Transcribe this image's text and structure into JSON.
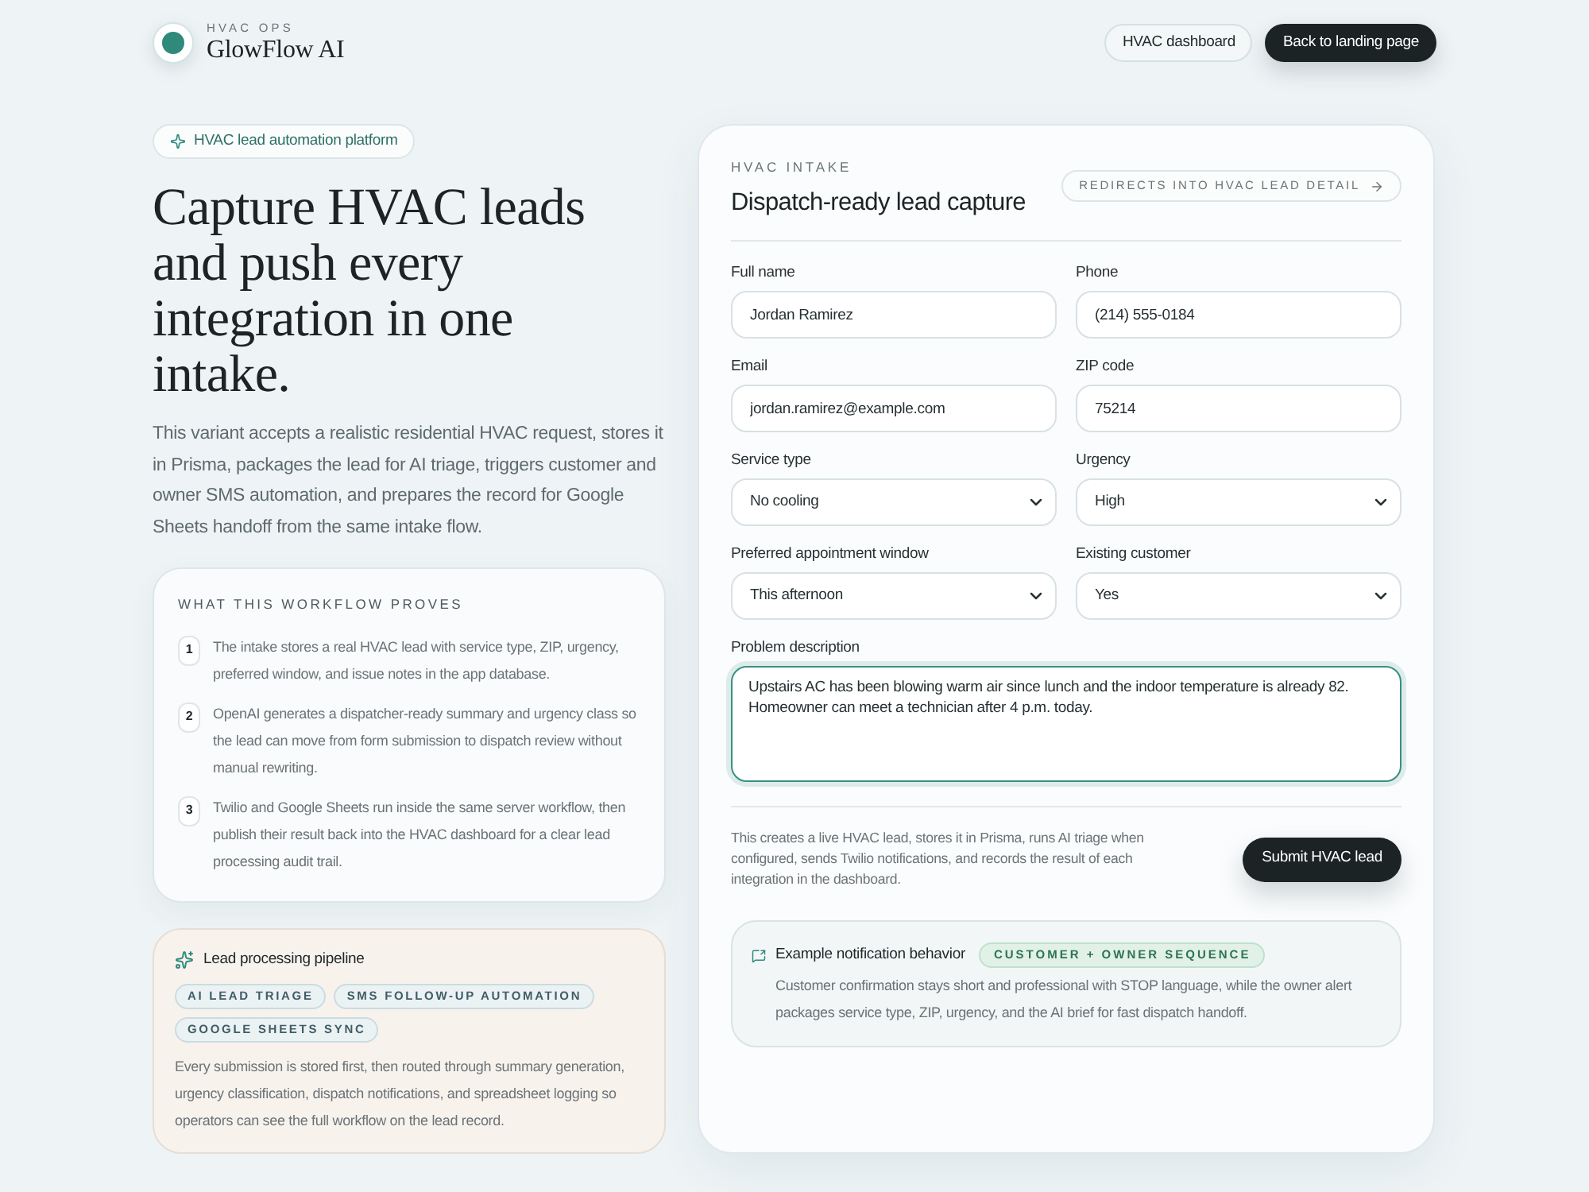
{
  "header": {
    "eyebrow": "HVAC OPS",
    "brand": "GlowFlow AI",
    "links": [
      {
        "label": "HVAC dashboard",
        "kind": "secondary"
      },
      {
        "label": "Back to landing page",
        "kind": "primary"
      }
    ]
  },
  "hero": {
    "badge": "HVAC lead automation platform",
    "title": "Capture HVAC leads and push every integration in one intake.",
    "description": "This variant accepts a realistic residential HVAC request, stores it in Prisma, packages the lead for AI triage, triggers customer and owner SMS automation, and prepares the record for Google Sheets handoff from the same intake flow."
  },
  "proof_card": {
    "title": "WHAT THIS WORKFLOW PROVES",
    "steps": [
      {
        "number": "1",
        "text": "The intake stores a real HVAC lead with service type, ZIP, urgency, preferred window, and issue notes in the app database."
      },
      {
        "number": "2",
        "text": "OpenAI generates a dispatcher-ready summary and urgency class so the lead can move from form submission to dispatch review without manual rewriting."
      },
      {
        "number": "3",
        "text": "Twilio and Google Sheets run inside the same server workflow, then publish their result back into the HVAC dashboard for a clear lead processing audit trail."
      }
    ]
  },
  "pipeline_card": {
    "title": "Lead processing pipeline",
    "tags": [
      "AI LEAD TRIAGE",
      "SMS FOLLOW-UP AUTOMATION",
      "GOOGLE SHEETS SYNC"
    ],
    "description": "Every submission is stored first, then routed through summary generation, urgency classification, dispatch notifications, and spreadsheet logging so operators can see the full workflow on the lead record."
  },
  "intake_form": {
    "eyebrow": "HVAC INTAKE",
    "title": "Dispatch-ready lead capture",
    "redirect_note": "REDIRECTS INTO HVAC LEAD DETAIL",
    "fields": [
      {
        "label": "Full name",
        "kind": "input",
        "value": "Jordan Ramirez"
      },
      {
        "label": "Phone",
        "kind": "input",
        "value": "(214) 555-0184"
      },
      {
        "label": "Email",
        "kind": "input",
        "value": "jordan.ramirez@example.com"
      },
      {
        "label": "ZIP code",
        "kind": "input",
        "value": "75214"
      },
      {
        "label": "Service type",
        "kind": "select",
        "value": "No cooling"
      },
      {
        "label": "Urgency",
        "kind": "select",
        "value": "High"
      },
      {
        "label": "Preferred appointment window",
        "kind": "select",
        "value": "This afternoon"
      },
      {
        "label": "Existing customer",
        "kind": "select",
        "value": "Yes"
      },
      {
        "label": "Problem description",
        "kind": "textarea",
        "value": "Upstairs AC has been blowing warm air since lunch and the indoor temperature is already 82. Homeowner can meet a technician after 4 p.m. today.",
        "focused": true
      }
    ],
    "footer_note": "This creates a live HVAC lead, stores it in Prisma, runs AI triage when configured, sends Twilio notifications, and records the result of each integration in the dashboard.",
    "submit_label": "Submit HVAC lead",
    "notification": {
      "title": "Example notification behavior",
      "tag": "CUSTOMER + OWNER SEQUENCE",
      "text": "Customer confirmation stays short and professional with STOP language, while the owner alert packages service type, ZIP, urgency, and the AI brief for fast dispatch handoff."
    }
  }
}
